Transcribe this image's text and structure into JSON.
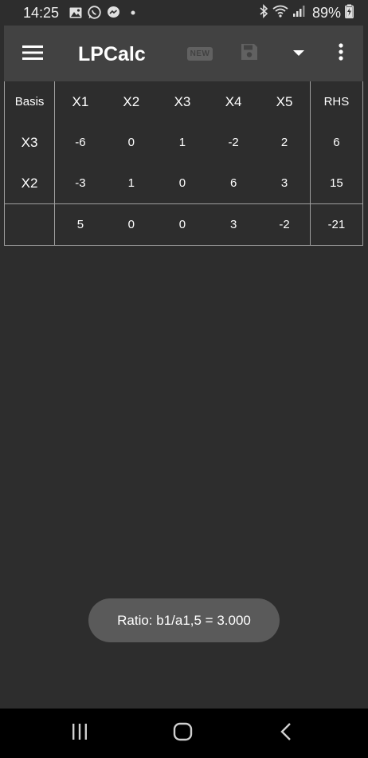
{
  "status_bar": {
    "time": "14:25",
    "battery": "89%",
    "icons_left": [
      "gallery-icon",
      "whatsapp-icon",
      "messenger-icon",
      "dot-icon"
    ],
    "icons_right": [
      "bluetooth-icon",
      "wifi-icon",
      "signal-icon",
      "battery-charging-icon"
    ]
  },
  "appbar": {
    "title": "LPCalc",
    "new_label": "NEW",
    "icons": [
      "menu-icon",
      "new-icon",
      "save-icon",
      "dropdown-icon",
      "more-vert-icon"
    ]
  },
  "tableau": {
    "headers": {
      "basis": "Basis",
      "vars": [
        {
          "base": "X",
          "sub": "1"
        },
        {
          "base": "X",
          "sub": "2"
        },
        {
          "base": "X",
          "sub": "3"
        },
        {
          "base": "X",
          "sub": "4"
        },
        {
          "base": "X",
          "sub": "5"
        }
      ],
      "rhs": "RHS"
    },
    "rows": [
      {
        "basis_base": "X",
        "basis_sub": "3",
        "values": [
          "-6",
          "0",
          "1",
          "-2",
          "2"
        ],
        "rhs": "6"
      },
      {
        "basis_base": "X",
        "basis_sub": "2",
        "values": [
          "-3",
          "1",
          "0",
          "6",
          "3"
        ],
        "rhs": "15"
      }
    ],
    "objective": {
      "basis": "",
      "values": [
        "5",
        "0",
        "0",
        "3",
        "-2"
      ],
      "rhs": "-21"
    }
  },
  "toast": {
    "text": "Ratio: b1/a1,5 = 3.000"
  },
  "nav_bar": {
    "icons": [
      "recent-apps-icon",
      "home-icon",
      "back-icon"
    ]
  }
}
